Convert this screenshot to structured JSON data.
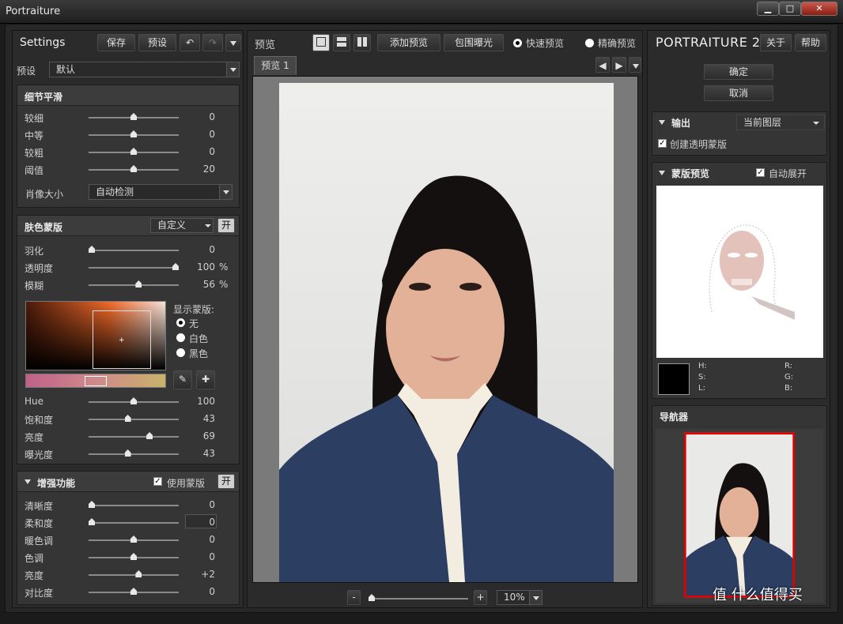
{
  "app_title": "Portraiture",
  "window_controls": {
    "minimize": "▁",
    "maximize": "□",
    "close": "✕"
  },
  "left": {
    "settings_label": "Settings",
    "save": "保存",
    "preset_btn": "预设",
    "preset_label": "预设",
    "preset_value": "默认",
    "detail": {
      "title": "细节平滑",
      "rows": [
        {
          "label": "较细",
          "value": "0",
          "pos": 0.5
        },
        {
          "label": "中等",
          "value": "0",
          "pos": 0.5
        },
        {
          "label": "较粗",
          "value": "0",
          "pos": 0.5
        },
        {
          "label": "阈值",
          "value": "20",
          "pos": 0.5
        }
      ],
      "portrait_size_label": "肖像大小",
      "portrait_size_value": "自动检测"
    },
    "skin": {
      "title": "肤色蒙版",
      "mode": "自定义",
      "toggle": "开",
      "rows": [
        {
          "label": "羽化",
          "value": "0",
          "unit": "",
          "pos": 0.0
        },
        {
          "label": "透明度",
          "value": "100",
          "unit": "%",
          "pos": 1.0
        },
        {
          "label": "模糊",
          "value": "56",
          "unit": "%",
          "pos": 0.56
        }
      ],
      "show_mask_label": "显示蒙版:",
      "show_options": [
        "无",
        "白色",
        "黑色"
      ],
      "hsl_rows": [
        {
          "label": "Hue",
          "value": "100",
          "pos": 0.5
        },
        {
          "label": "饱和度",
          "value": "43",
          "pos": 0.43
        },
        {
          "label": "亮度",
          "value": "69",
          "pos": 0.69
        },
        {
          "label": "曝光度",
          "value": "43",
          "pos": 0.43
        }
      ]
    },
    "enhance": {
      "title": "增强功能",
      "use_mask": "使用蒙版",
      "toggle": "开",
      "rows": [
        {
          "label": "清晰度",
          "value": "0",
          "pos": 0.0
        },
        {
          "label": "柔和度",
          "value": "0",
          "pos": 0.0
        },
        {
          "label": "暖色调",
          "value": "0",
          "pos": 0.5
        },
        {
          "label": "色调",
          "value": "0",
          "pos": 0.5
        },
        {
          "label": "亮度",
          "value": "+2",
          "pos": 0.56
        },
        {
          "label": "对比度",
          "value": "0",
          "pos": 0.5
        }
      ]
    }
  },
  "center": {
    "preview_label": "预览",
    "add_preview": "添加预览",
    "bracket": "包围曝光",
    "fast_preview": "快速预览",
    "accurate_preview": "精确预览",
    "tab": "预览 1",
    "zoom_minus": "-",
    "zoom_plus": "+",
    "zoom_value": "10%"
  },
  "right": {
    "product_name": "PORTRAITURE 2",
    "about": "关于",
    "help": "帮助",
    "ok": "确定",
    "cancel": "取消",
    "output_label": "输出",
    "output_value": "当前图层",
    "create_mask": "创建透明蒙版",
    "mask_preview": "蒙版预览",
    "auto_expand": "自动展开",
    "info": {
      "h": "H:",
      "s": "S:",
      "l": "L:",
      "r": "R:",
      "g": "G:",
      "b": "B:"
    },
    "navigator": "导航器",
    "watermark": "值 什么值得买"
  }
}
